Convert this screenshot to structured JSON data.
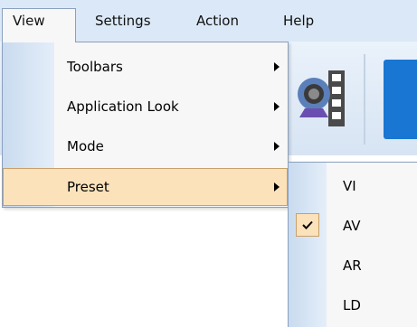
{
  "menubar": {
    "items": [
      {
        "label": "View"
      },
      {
        "label": "Settings"
      },
      {
        "label": "Action"
      },
      {
        "label": "Help"
      }
    ]
  },
  "view_menu": {
    "items": [
      {
        "label": "Toolbars",
        "has_submenu": true
      },
      {
        "label": "Application Look",
        "has_submenu": true
      },
      {
        "label": "Mode",
        "has_submenu": true
      },
      {
        "label": "Preset",
        "has_submenu": true,
        "highlighted": true
      }
    ]
  },
  "preset_submenu": {
    "items": [
      {
        "label": "VI",
        "checked": false
      },
      {
        "label": "AV",
        "checked": true
      },
      {
        "label": "AR",
        "checked": false
      },
      {
        "label": "LD",
        "checked": false
      }
    ]
  },
  "toolbar": {
    "icons": [
      "webcam-film-icon"
    ]
  },
  "colors": {
    "menubar_bg": "#dbe8f7",
    "highlight": "#fbe2bb",
    "highlight_border": "#c8a06a",
    "icon_strip": "#c9dbef",
    "accent_blue": "#1976d2"
  }
}
